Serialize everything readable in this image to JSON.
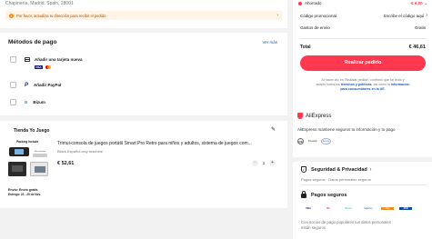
{
  "address": {
    "line": "Chapinería, Madrid, Spain, 28001",
    "notice": "Por favor, actualiza tu dirección para recibir el pedido",
    "notice_icon": "warning-icon"
  },
  "payment": {
    "title": "Métodos de pago",
    "see_more": "Ver más",
    "options": [
      {
        "label": "Añadir una tarjeta nueva",
        "icon": "credit-card-icon"
      },
      {
        "label": "Añadir PayPal",
        "icon": "paypal-icon"
      },
      {
        "label": "Bizum",
        "icon": "bizum-icon"
      }
    ],
    "card_brands": [
      "VISA",
      "MC"
    ]
  },
  "store": {
    "name": "Tienda Yo Juego",
    "edit_icon": "pencil-icon",
    "product": {
      "thumb_label": "Packing Include",
      "thumb_sub": "Main machine",
      "title": "Trimui-consola de juegos portátil Smart Pro Retro para niños y adultos, sistema de juegos com...",
      "variant": "Black.Español.only machine",
      "price": "€ 52,61",
      "quantity": "1",
      "minus": "−",
      "plus": "+"
    },
    "shipping": {
      "label": "Envío: Envío gratis",
      "delivery": "Entrega: 22 - 29 de Nov."
    }
  },
  "summary": {
    "saved_label": "Ahorrado",
    "saved_value": "-€ 6,00",
    "promo_label": "Código promocional",
    "promo_value": "Escribe el código aquí",
    "shipping_label": "Gastos de envío",
    "shipping_value": "Gratis",
    "total_label": "Total",
    "total_value": "€ 46,61",
    "button": "Realizar pedido",
    "legal_1": "Al hacer clic en 'Realizar pedido', confirmo que he leído y",
    "legal_2a": "acepto todos los ",
    "legal_2_link": "términos y políticas",
    "legal_2b": ", así como la ",
    "legal_2_link2": "información",
    "legal_3_link": "para consumidores en la UE",
    "legal_3b": "."
  },
  "aliexpress": {
    "title": "AliExpress",
    "desc": "AliExpress mantiene seguros tu información y tu pago",
    "logo_icon": "aliexpress-shield-icon",
    "badges": [
      "CE",
      "Trusted",
      "Secure"
    ]
  },
  "security": {
    "title": "Seguridad & Privacidad",
    "subtitle": "Pagos seguros · Datos personales seguros",
    "pay_title": "Pagos seguros",
    "methods": [
      "VISA",
      "MC",
      "Bizum",
      "SafeKey",
      "Pay",
      "JCB"
    ],
    "desc_1": "Con socios de pago populares tus datos personales",
    "desc_2": "están seguros"
  },
  "colors": {
    "accent": "#fd384f",
    "link": "#1b5ab8",
    "notice_bg": "#fff4e6",
    "notice_text": "#a25100"
  }
}
